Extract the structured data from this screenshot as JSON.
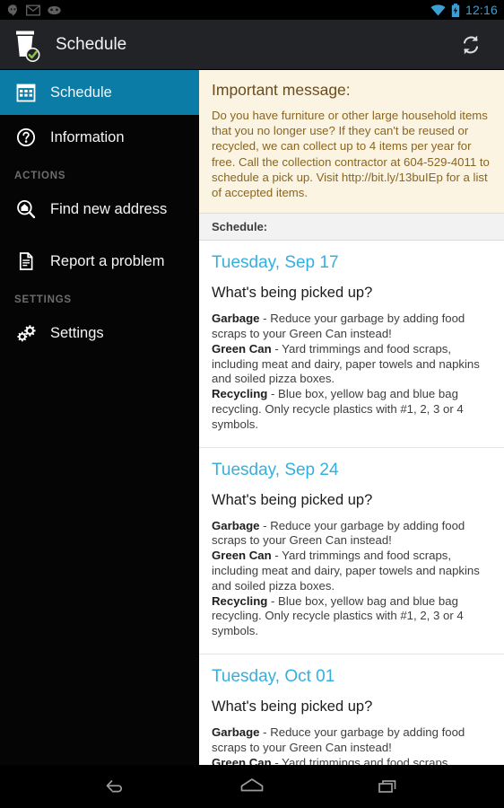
{
  "statusbar": {
    "icons": [
      "hangouts-icon",
      "gmail-icon",
      "cyanogenmod-icon"
    ],
    "wifi_icon": "wifi-icon",
    "battery_icon": "battery-charging-icon",
    "clock": "12:16"
  },
  "actionbar": {
    "app_icon": "trash-bin-check-icon",
    "title": "Schedule",
    "refresh_label": "refresh-icon"
  },
  "drawer": {
    "items": [
      {
        "label": "Schedule",
        "icon": "calendar-icon",
        "selected": true
      },
      {
        "label": "Information",
        "icon": "question-mark-icon",
        "selected": false
      }
    ],
    "actions_header": "ACTIONS",
    "action_items": [
      {
        "label": "Find new address",
        "icon": "search-home-icon"
      },
      {
        "label": "Report a problem",
        "icon": "document-icon"
      }
    ],
    "settings_header": "SETTINGS",
    "settings_items": [
      {
        "label": "Settings",
        "icon": "gears-icon"
      }
    ]
  },
  "message": {
    "title": "Important message:",
    "body": "Do you have furniture or other large household items that you no longer use? If they can't be reused or recycled, we can collect up to 4 items per year for free. Call the collection contractor at 604-529-4011 to schedule a pick up. Visit http://bit.ly/13buIEp for a list of accepted items."
  },
  "schedule": {
    "header": "Schedule:",
    "entries": [
      {
        "date": "Tuesday, Sep 17",
        "question": "What's being picked up?",
        "items": [
          {
            "name": "Garbage",
            "desc": " - Reduce your garbage by adding food scraps to your Green Can instead!"
          },
          {
            "name": "Green Can",
            "desc": " - Yard trimmings and food scraps, including meat and dairy, paper towels and napkins and soiled pizza boxes."
          },
          {
            "name": "Recycling",
            "desc": " - Blue box, yellow bag and blue bag recycling. Only recycle plastics with #1, 2, 3 or 4 symbols."
          }
        ]
      },
      {
        "date": "Tuesday, Sep 24",
        "question": "What's being picked up?",
        "items": [
          {
            "name": "Garbage",
            "desc": " - Reduce your garbage by adding food scraps to your Green Can instead!"
          },
          {
            "name": "Green Can",
            "desc": " - Yard trimmings and food scraps, including meat and dairy, paper towels and napkins and soiled pizza boxes."
          },
          {
            "name": "Recycling",
            "desc": " - Blue box, yellow bag and blue bag recycling. Only recycle plastics with #1, 2, 3 or 4 symbols."
          }
        ]
      },
      {
        "date": "Tuesday, Oct 01",
        "question": "What's being picked up?",
        "items": [
          {
            "name": "Garbage",
            "desc": " - Reduce your garbage by adding food scraps to your Green Can instead!"
          },
          {
            "name": "Green Can",
            "desc": " - Yard trimmings and food scraps, including meat and dairy, paper towels and napkins"
          }
        ]
      }
    ]
  },
  "navbar": {
    "back": "back-icon",
    "home": "home-icon",
    "recents": "recents-icon"
  },
  "colors": {
    "accent_drawer": "#0b7ca6",
    "accent_date": "#33b0e0",
    "clock": "#3d9fd4",
    "message_bg": "#fbf4e2",
    "message_text": "#8a6521"
  }
}
